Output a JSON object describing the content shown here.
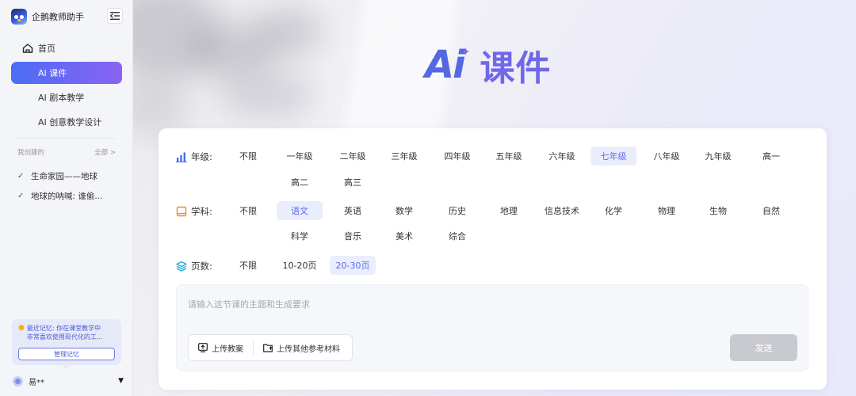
{
  "app": {
    "name": "企鹅教师助手"
  },
  "nav": [
    {
      "label": "首页",
      "icon": "home-icon"
    },
    {
      "label": "AI 课件",
      "active": true
    },
    {
      "label": "AI 剧本教学"
    },
    {
      "label": "AI 创意教学设计"
    }
  ],
  "my_created": {
    "title": "我创建的",
    "all_label": "全部 >"
  },
  "history": [
    "生命家园——地球",
    "地球的呐喊: 谁偷..."
  ],
  "memory": {
    "text": "最近记忆: 你在课堂教学中非常喜欢使用现代化的工...",
    "line1": "最近记忆: 你在课堂教学中",
    "line2": "非常喜欢使用现代化的工...",
    "button_label": "管理记忆"
  },
  "user": {
    "name": "易**"
  },
  "hero": {
    "ai": "Ai",
    "title": "课件"
  },
  "filters": {
    "grade": {
      "label": "年级:",
      "options": [
        "不限",
        "一年级",
        "二年级",
        "三年级",
        "四年级",
        "五年级",
        "六年级",
        "七年级",
        "八年级",
        "九年级",
        "高一",
        "高二",
        "高三"
      ],
      "selected": "七年级"
    },
    "subject": {
      "label": "学科:",
      "options": [
        "不限",
        "语文",
        "英语",
        "数学",
        "历史",
        "地理",
        "信息技术",
        "化学",
        "物理",
        "生物",
        "自然",
        "科学",
        "音乐",
        "美术",
        "综合"
      ],
      "selected": "语文"
    },
    "pages": {
      "label": "页数:",
      "options": [
        "不限",
        "10-20页",
        "20-30页"
      ],
      "selected": "20-30页"
    }
  },
  "prompt": {
    "placeholder": "请输入这节课的主题和生成要求",
    "upload_lesson_label": "上传教案",
    "upload_other_label": "上传其他参考材料",
    "send_label": "发送"
  },
  "colors": {
    "accent": "#5b6cf0",
    "nav_gradient_start": "#4b6cf7",
    "nav_gradient_end": "#8a63f2",
    "send_disabled": "#c9cad0"
  }
}
